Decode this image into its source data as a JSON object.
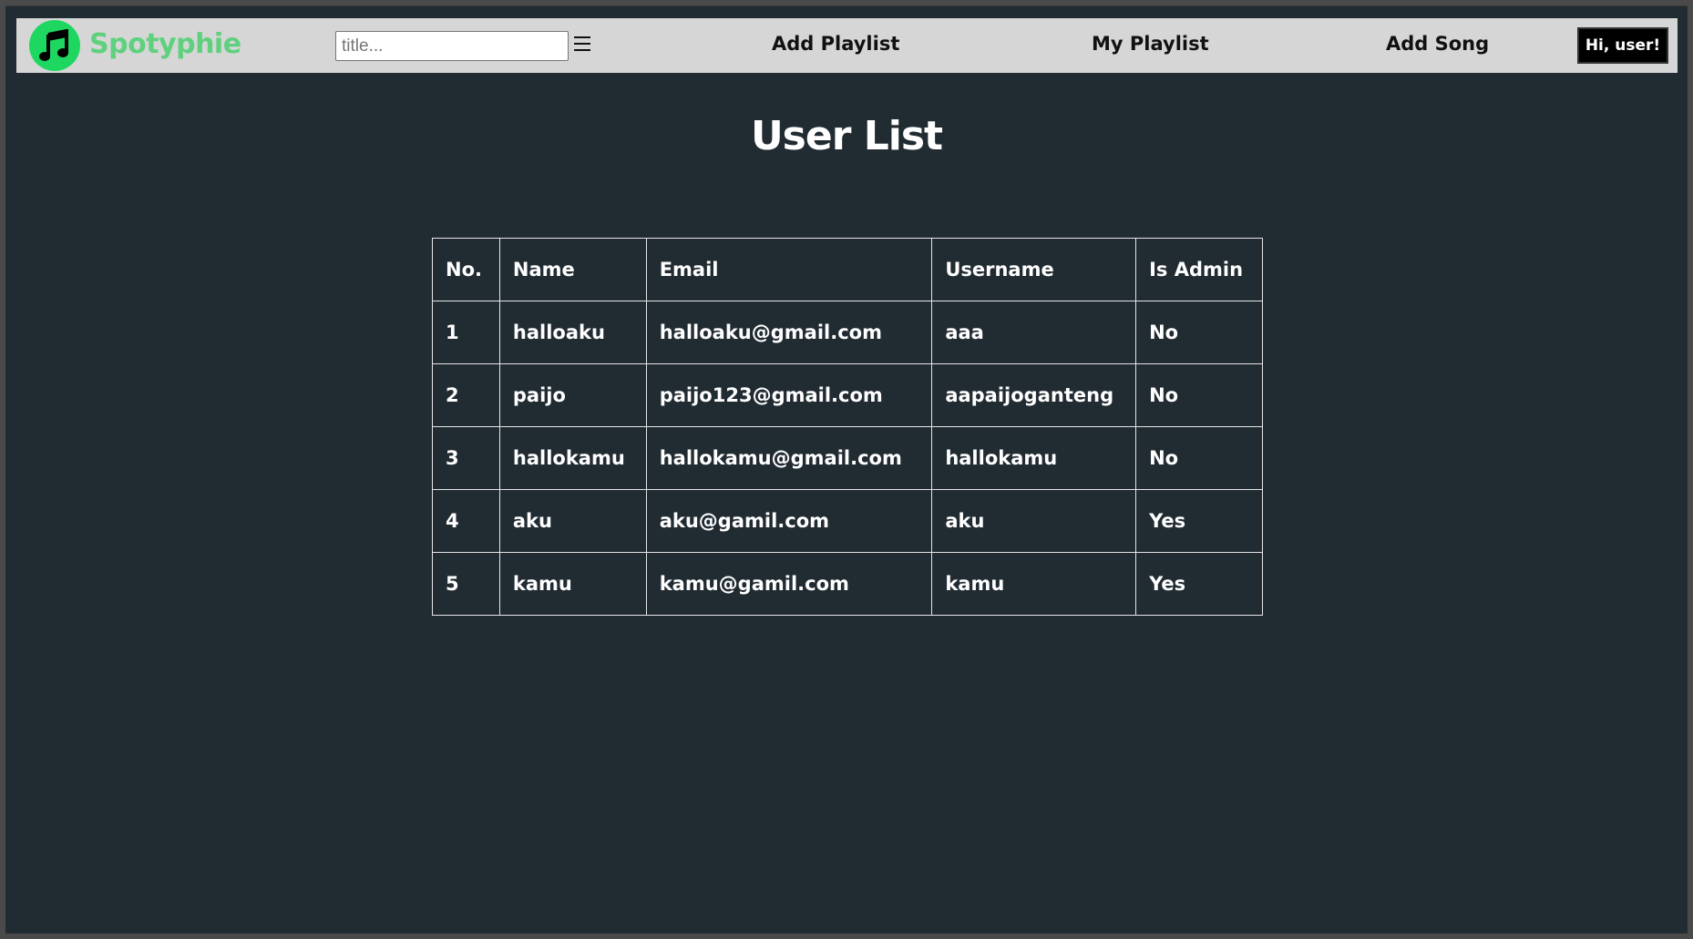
{
  "brand": {
    "name": "Spotyphie",
    "logo_icon": "music-note-icon",
    "accent_color": "#1ed760"
  },
  "header": {
    "search_placeholder": "title...",
    "nav_links": [
      "Add Playlist",
      "My Playlist",
      "Add Song"
    ],
    "user_button": "Hi, user!"
  },
  "main": {
    "title": "User List",
    "table": {
      "headers": [
        "No.",
        "Name",
        "Email",
        "Username",
        "Is Admin"
      ],
      "rows": [
        [
          "1",
          "halloaku",
          "halloaku@gmail.com",
          "aaa",
          "No"
        ],
        [
          "2",
          "paijo",
          "paijo123@gmail.com",
          "aapaijoganteng",
          "No"
        ],
        [
          "3",
          "hallokamu",
          "hallokamu@gmail.com",
          "hallokamu",
          "No"
        ],
        [
          "4",
          "aku",
          "aku@gamil.com",
          "aku",
          "Yes"
        ],
        [
          "5",
          "kamu",
          "kamu@gamil.com",
          "kamu",
          "Yes"
        ]
      ]
    }
  }
}
